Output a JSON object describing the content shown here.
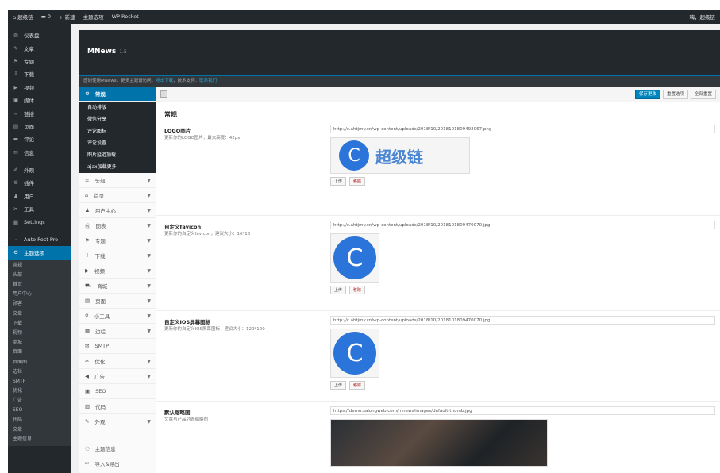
{
  "adminbar": {
    "site": "超级链",
    "comments": "0",
    "new": "新建",
    "theme": "主题选项",
    "plugin": "WP Rocket",
    "greeting": "嗨，超级链"
  },
  "sidebar": {
    "items": [
      {
        "icon": "dashboard-icon",
        "g": "◍",
        "label": "仪表盘"
      },
      {
        "icon": "pin-icon",
        "g": "✎",
        "label": "文章"
      },
      {
        "icon": "flag-icon",
        "g": "⚑",
        "label": "专题"
      },
      {
        "icon": "download-icon",
        "g": "⇩",
        "label": "下载"
      },
      {
        "icon": "video-icon",
        "g": "▶",
        "label": "视频"
      },
      {
        "icon": "media-icon",
        "g": "▣",
        "label": "媒体"
      },
      {
        "icon": "link-icon",
        "g": "∞",
        "label": "链接"
      },
      {
        "icon": "page-icon",
        "g": "▤",
        "label": "页面"
      },
      {
        "icon": "comment-icon",
        "g": "▬",
        "label": "评论"
      },
      {
        "icon": "mail-icon",
        "g": "✉",
        "label": "信息"
      },
      {
        "icon": "brush-icon",
        "g": "✐",
        "label": "外观"
      },
      {
        "icon": "plugin-icon",
        "g": "⚙",
        "label": "插件"
      },
      {
        "icon": "user-icon",
        "g": "♟",
        "label": "用户"
      },
      {
        "icon": "wrench-icon",
        "g": "✂",
        "label": "工具"
      },
      {
        "icon": "settings-icon",
        "g": "▦",
        "label": "Settings"
      },
      {
        "icon": "autopost-icon",
        "g": "·",
        "label": "Auto Post Pro"
      }
    ],
    "active": {
      "label": "主题选项"
    },
    "submenu": [
      "常规",
      "头部",
      "首页",
      "用户中心",
      "顾客",
      "文章",
      "下载",
      "视频",
      "商城",
      "页面",
      "页面图",
      "边栏",
      "SMTP",
      "优化",
      "广告",
      "SEO",
      "代码",
      "文章",
      "主题信息"
    ]
  },
  "header": {
    "title": "MNews",
    "version": "1.5",
    "notice": "感谢使用MNews，更多主题请访问：",
    "link1": "点击下载",
    "notice2": "，技术支持：",
    "link2": "联系我们"
  },
  "nav": {
    "active": "常规",
    "children": [
      "自动排版",
      "微信分享",
      "评论图标",
      "评论设置",
      "图片延迟加载",
      "ajax加载更多"
    ],
    "items": [
      {
        "g": "≡",
        "label": "头部",
        "c": true
      },
      {
        "g": "⌂",
        "label": "首页",
        "c": true
      },
      {
        "g": "♟",
        "label": "用户中心",
        "c": true
      },
      {
        "g": "Ⓦ",
        "label": "图表",
        "c": true
      },
      {
        "g": "⚑",
        "label": "专题",
        "c": true
      },
      {
        "g": "⇩",
        "label": "下载",
        "c": true
      },
      {
        "g": "▶",
        "label": "视频",
        "c": true
      },
      {
        "g": "⛟",
        "label": "商城",
        "c": true
      },
      {
        "g": "▤",
        "label": "页面",
        "c": true
      },
      {
        "g": "⚲",
        "label": "小工具",
        "c": true
      },
      {
        "g": "▦",
        "label": "边栏",
        "c": true
      },
      {
        "g": "✉",
        "label": "SMTP",
        "c": false
      },
      {
        "g": "✂",
        "label": "优化",
        "c": true
      },
      {
        "g": "◀",
        "label": "广告",
        "c": true
      },
      {
        "g": "▣",
        "label": "SEO",
        "c": false
      },
      {
        "g": "▥",
        "label": "代码",
        "c": false
      },
      {
        "g": "✎",
        "label": "外观",
        "c": true
      }
    ],
    "footer": [
      {
        "g": "◌",
        "label": "主题信息"
      },
      {
        "g": "✂",
        "label": "导入&导出"
      }
    ]
  },
  "toolbar": {
    "save": "保存更改",
    "reset_section": "重置选项",
    "reset_all": "全部重置"
  },
  "section_title": "常规",
  "fields": [
    {
      "label": "LOGO图片",
      "desc": "更新你的LOGO图片，最大高度：42px",
      "value": "http://c.ahtjmy.cn/wp-content/uploads/2018/10/2018101809492067.png",
      "preview_text": "超级链",
      "upload": "上传",
      "remove": "移除"
    },
    {
      "label": "自定义favicon",
      "desc": "更新你的自定义favicon，建议大小：16*16",
      "value": "http://c.ahtjmy.cn/wp-content/uploads/2018/10/2018101809470070.jpg",
      "upload": "上传",
      "remove": "移除"
    },
    {
      "label": "自定义IOS屏幕图标",
      "desc": "更新你的自定义IOS屏幕图标，建议大小：120*120",
      "value": "http://c.ahtjmy.cn/wp-content/uploads/2018/10/2018101809470070.jpg",
      "upload": "上传",
      "remove": "移除"
    },
    {
      "label": "默认缩略图",
      "desc": "文章与产品列表缩略图",
      "value": "https://demo.salongweb.com/mnews/images/default-thumb.jpg"
    }
  ],
  "colors": {
    "accent": "#0073aa",
    "dark": "#23282d",
    "logo_blue": "#2b74d9"
  }
}
